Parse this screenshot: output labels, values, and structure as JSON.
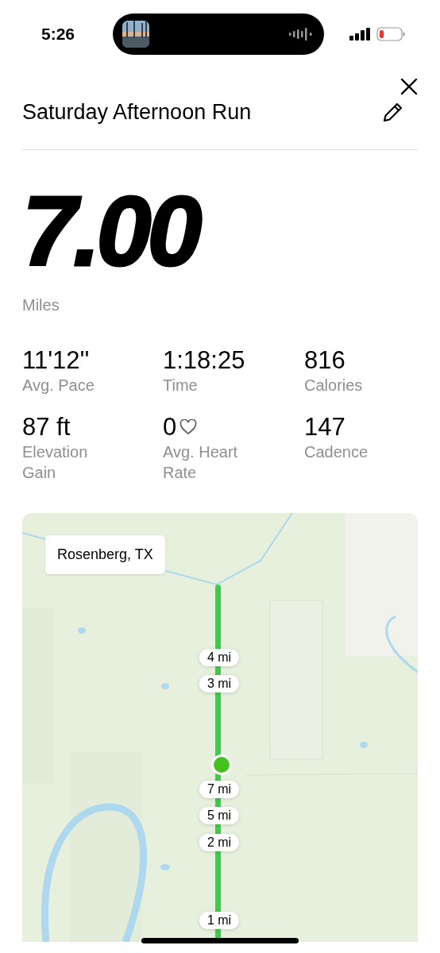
{
  "status_bar": {
    "time": "5:26"
  },
  "header": {
    "title": "Saturday Afternoon Run"
  },
  "distance": {
    "value": "7.00",
    "unit": "Miles"
  },
  "stats": [
    {
      "kind": "plain",
      "value": "11'12''",
      "label": "Avg. Pace"
    },
    {
      "kind": "plain",
      "value": "1:18:25",
      "label": "Time"
    },
    {
      "kind": "plain",
      "value": "816",
      "label": "Calories"
    },
    {
      "kind": "plain",
      "value": "87 ft",
      "label": "Elevation Gain"
    },
    {
      "kind": "heart",
      "value": "0",
      "label": "Avg. Heart Rate"
    },
    {
      "kind": "plain",
      "value": "147",
      "label": "Cadence"
    }
  ],
  "map": {
    "location": "Rosenberg, TX",
    "markers": [
      "4 mi",
      "3 mi",
      "7 mi",
      "5 mi",
      "2 mi",
      "1 mi"
    ]
  }
}
